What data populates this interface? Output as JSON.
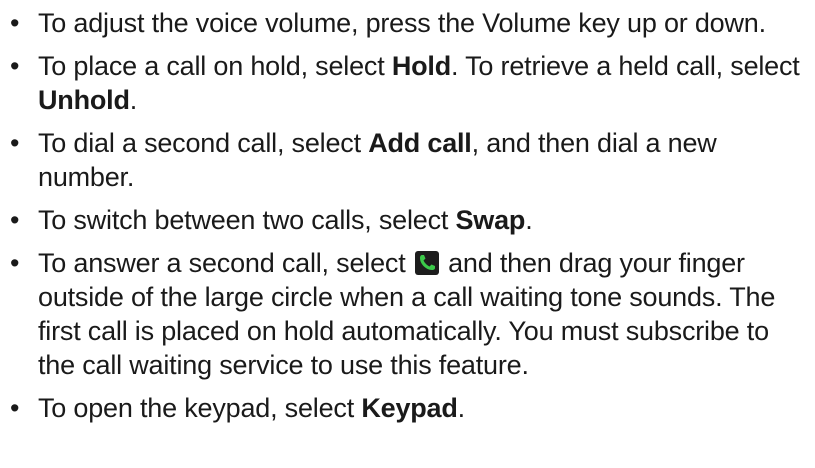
{
  "items": [
    {
      "t1": "To adjust the voice volume, press the Volume key up or down."
    },
    {
      "t1": "To place a call on hold, select ",
      "b1": "Hold",
      "t2": ". To retrieve a held call, select ",
      "b2": "Unhold",
      "t3": "."
    },
    {
      "t1": "To dial a second call, select ",
      "b1": "Add call",
      "t2": ", and then dial a new number."
    },
    {
      "t1": "To switch between two calls, select ",
      "b1": "Swap",
      "t2": "."
    },
    {
      "t1": "To answer a second call, select ",
      "icon": "phone-call-icon",
      "t2": " and then drag your finger outside of the large circle when a call waiting tone sounds. The first call is placed on hold automatically. You must subscribe to the call waiting service to use this feature."
    },
    {
      "t1": "To open the keypad, select ",
      "b1": "Keypad",
      "t2": "."
    }
  ],
  "bullet_char": "•",
  "colors": {
    "text": "#1a1a1a",
    "icon_bg": "#1d1d1d",
    "icon_fg": "#3cc94a"
  }
}
